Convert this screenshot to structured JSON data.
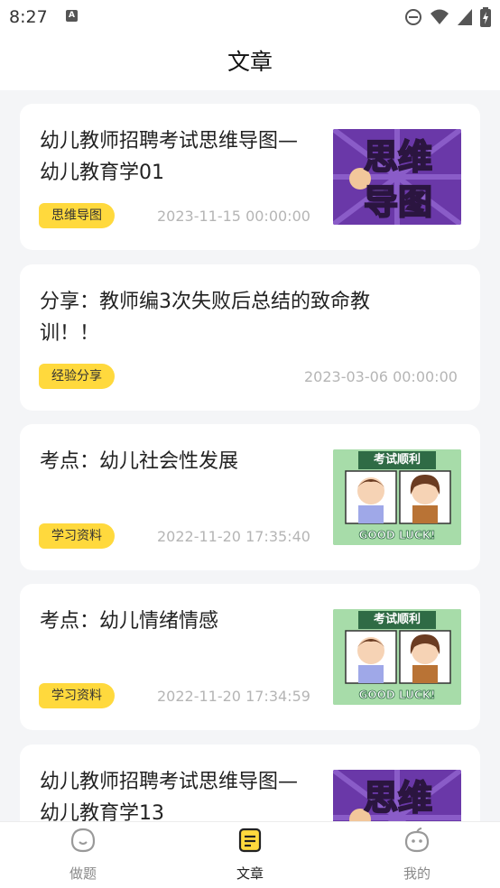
{
  "status": {
    "time": "8:27",
    "badge": "A"
  },
  "header": {
    "title": "文章"
  },
  "articles": [
    {
      "title": "幼儿教师招聘考试思维导图—幼儿教育学01",
      "tag": "思维导图",
      "date": "2023-11-15 00:00:00",
      "thumb": "思维导图"
    },
    {
      "title": "分享：教师编3次失败后总结的致命教训！！",
      "tag": "经验分享",
      "date": "2023-03-06 00:00:00"
    },
    {
      "title": "考点：幼儿社会性发展",
      "tag": "学习资料",
      "date": "2022-11-20 17:35:40",
      "thumb_banner": "考试顺利",
      "thumb_footer": "GOOD LUCK!"
    },
    {
      "title": "考点：幼儿情绪情感",
      "tag": "学习资料",
      "date": "2022-11-20 17:34:59",
      "thumb_banner": "考试顺利",
      "thumb_footer": "GOOD LUCK!"
    },
    {
      "title": "幼儿教师招聘考试思维导图—幼儿教育学13",
      "thumb": "思维导图"
    }
  ],
  "tabs": [
    {
      "label": "做题",
      "icon": "face-icon"
    },
    {
      "label": "文章",
      "icon": "article-icon",
      "active": true
    },
    {
      "label": "我的",
      "icon": "profile-icon"
    }
  ],
  "colors": {
    "tag_bg": "#ffd93d",
    "thumb_purple": "#6a38a8",
    "thumb_green": "#a7dca9"
  }
}
